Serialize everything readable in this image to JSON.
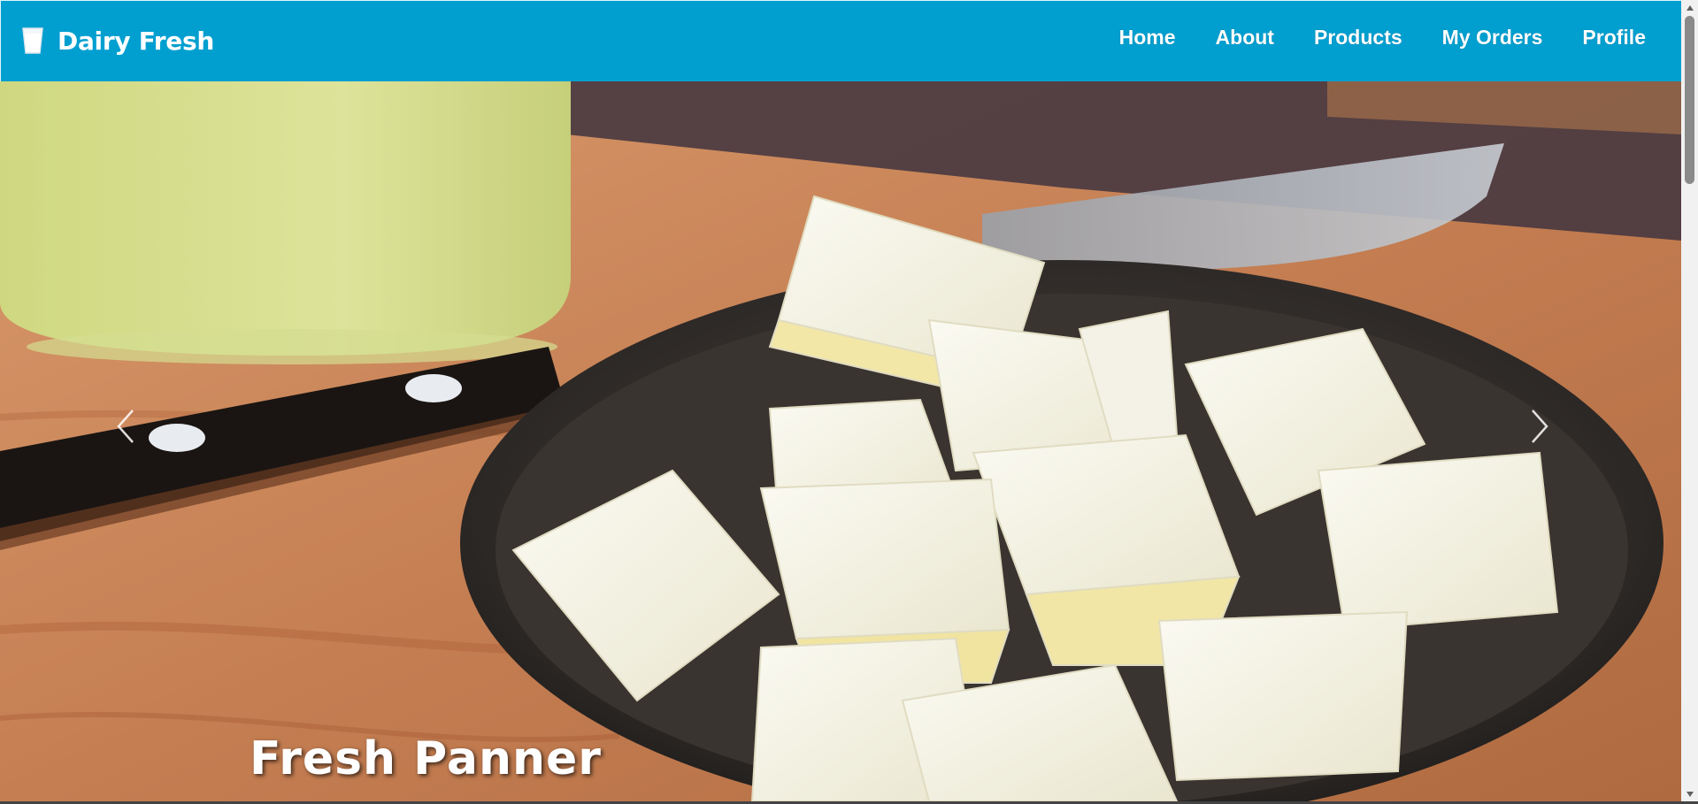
{
  "brand": {
    "name": "Dairy Fresh",
    "icon": "milk-glass-icon"
  },
  "nav": {
    "items": [
      "Home",
      "About",
      "Products",
      "My Orders",
      "Profile"
    ]
  },
  "carousel": {
    "caption": "Fresh Panner",
    "prev_icon": "chevron-left-icon",
    "next_icon": "chevron-right-icon"
  },
  "colors": {
    "navbar_bg": "#009fd0",
    "nav_text": "#ffffff",
    "caption_text": "#ffffff"
  }
}
